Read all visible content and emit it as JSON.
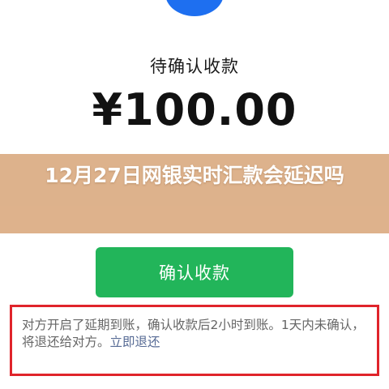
{
  "header": {
    "status_label": "待确认收款",
    "amount": "¥100.00"
  },
  "banner": {
    "title": "12月27日网银实时汇款会延迟吗"
  },
  "actions": {
    "confirm_label": "确认收款"
  },
  "notice": {
    "text": "对方开启了延期到账，确认收款后2小时到账。1天内未确认，将退还给对方。",
    "link_label": "立即退还"
  },
  "colors": {
    "primary_button": "#22b55a",
    "banner_overlay": "#dcae86",
    "highlight_border": "#e0242b",
    "link": "#576b95",
    "icon_blue": "#1e6ff0"
  },
  "icons": {
    "top": "clock-icon"
  }
}
